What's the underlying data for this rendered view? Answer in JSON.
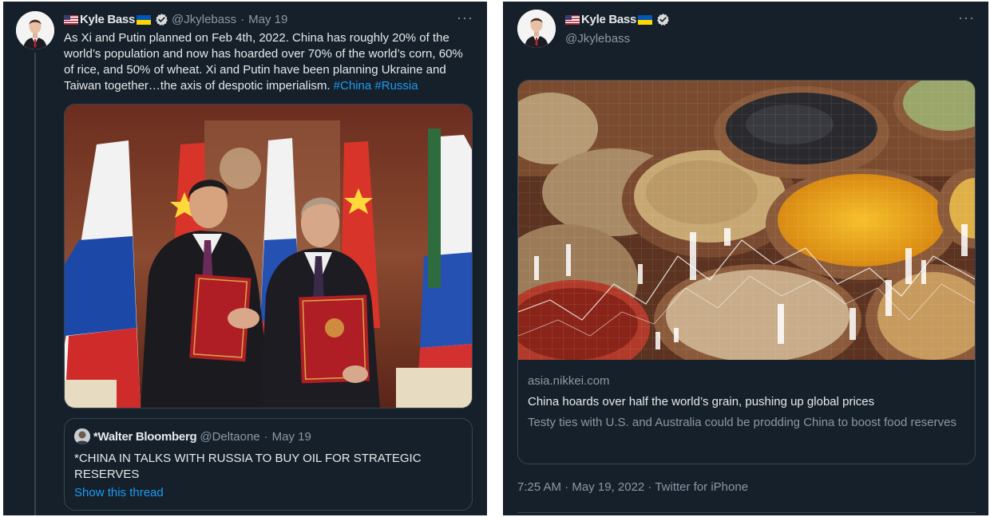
{
  "left_tweet": {
    "author_name": "Kyle Bass",
    "handle": "@Jkylebass",
    "separator": "·",
    "date": "May 19",
    "more": "···",
    "text": "As Xi and Putin planned on Feb 4th, 2022. China has roughly 20% of the world’s population and now has hoarded over 70% of the world’s corn, 60% of rice, and 50% of wheat. Xi and Putin have been planning Ukraine and Taiwan together…the axis of despotic imperialism.",
    "hashtags": [
      "#China",
      "#Russia"
    ],
    "quote": {
      "author_name": "*Walter Bloomberg",
      "handle": "@Deltaone",
      "separator": "·",
      "date": "May 19",
      "text": "*CHINA IN TALKS WITH RUSSIA TO BUY OIL FOR STRATEGIC RESERVES",
      "show_thread": "Show this thread"
    }
  },
  "right_tweet": {
    "author_name": "Kyle Bass",
    "handle": "@Jkylebass",
    "more": "···",
    "link_card": {
      "domain": "asia.nikkei.com",
      "title": "China hoards over half the world’s grain, pushing up global prices",
      "description": "Testy ties with U.S. and Australia could be prodding China to boost food reserves"
    },
    "timestamp": "7:25 AM · May 19, 2022 · Twitter for iPhone"
  },
  "icons": {
    "verified": "verified-badge-icon",
    "flag_prefix": "us-flag-icon",
    "flag_suffix": "ukraine-flag-icon",
    "more": "more-options-icon"
  },
  "colors": {
    "background": "#15202b",
    "text": "#e7e9ea",
    "muted": "#8b98a5",
    "link": "#1d9bf0",
    "border": "#38444d",
    "verified": "#d9d9d9"
  }
}
